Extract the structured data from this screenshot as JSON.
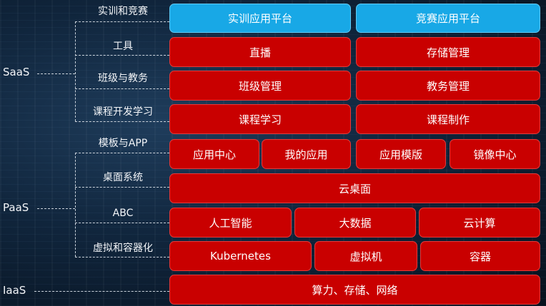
{
  "layers": {
    "saas": "SaaS",
    "paas": "PaaS",
    "iaas": "IaaS"
  },
  "categories": [
    "实训和竞赛",
    "工具",
    "班级与教务",
    "课程开发学习",
    "模板与APP",
    "桌面系统",
    "ABC",
    "虚拟和容器化"
  ],
  "rows": {
    "r1": [
      "实训应用平台",
      "竞赛应用平台"
    ],
    "r2": [
      "直播",
      "存储管理"
    ],
    "r3": [
      "班级管理",
      "教务管理"
    ],
    "r4": [
      "课程学习",
      "课程制作"
    ],
    "r5": [
      "应用中心",
      "我的应用",
      "应用模版",
      "镜像中心"
    ],
    "r6": [
      "云桌面"
    ],
    "r7": [
      "人工智能",
      "大数据",
      "云计算"
    ],
    "r8": [
      "Kubernetes",
      "虚拟机",
      "容器"
    ],
    "r9": [
      "算力、存储、网络"
    ]
  },
  "colors": {
    "red": "#c90000",
    "blue": "#18a8e6"
  }
}
